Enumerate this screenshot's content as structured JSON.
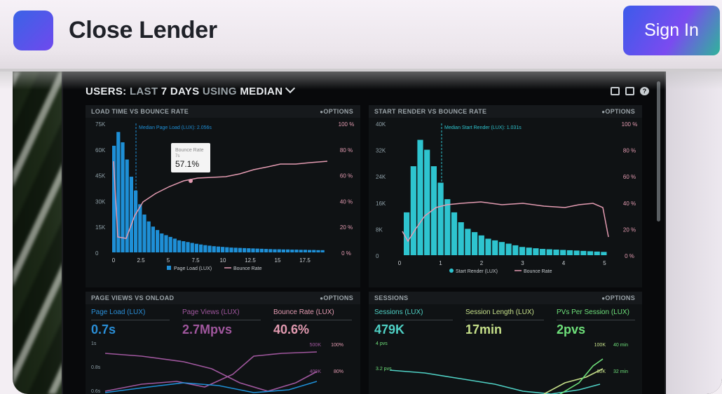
{
  "header": {
    "brand": "Close Lender",
    "sign_in_label": "Sign In",
    "logo_colors": [
      "#3a63e6",
      "#6f49ee"
    ]
  },
  "dashboard": {
    "title_users": "USERS:",
    "title_last": "LAST",
    "title_days": "7 DAYS",
    "title_using": "USING",
    "title_median": "MEDIAN",
    "icons": [
      "monitor-icon",
      "share-icon",
      "help-icon"
    ],
    "options_label": "OPTIONS",
    "panels": {
      "load": {
        "title": "LOAD TIME VS BOUNCE RATE",
        "median_label": "Median Page Load (LUX): 2.056s",
        "tooltip_label": "Bounce Rate",
        "tooltip_sub": "7s",
        "tooltip_value": "57.1%",
        "legend": [
          "Page Load (LUX)",
          "Bounce Rate"
        ]
      },
      "render": {
        "title": "START RENDER VS BOUNCE RATE",
        "median_label": "Median Start Render (LUX): 1.031s",
        "legend": [
          "Start Render (LUX)",
          "Bounce Rate"
        ]
      },
      "pageviews": {
        "title": "PAGE VIEWS VS ONLOAD",
        "metrics": [
          {
            "label": "Page Load (LUX)",
            "value": "0.7s",
            "color": "#2a8fd8"
          },
          {
            "label": "Page Views (LUX)",
            "value": "2.7Mpvs",
            "color": "#a0579e"
          },
          {
            "label": "Bounce Rate (LUX)",
            "value": "40.6%",
            "color": "#e39bb1"
          }
        ]
      },
      "sessions": {
        "title": "SESSIONS",
        "metrics": [
          {
            "label": "Sessions (LUX)",
            "value": "479K",
            "color": "#4fd1c5"
          },
          {
            "label": "Session Length (LUX)",
            "value": "17min",
            "color": "#c6e08a"
          },
          {
            "label": "PVs Per Session (LUX)",
            "value": "2pvs",
            "color": "#6ee07a"
          }
        ]
      }
    },
    "axes": {
      "load_y_left": [
        "75K",
        "60K",
        "45K",
        "30K",
        "15K",
        "0"
      ],
      "load_y_right": [
        "100 %",
        "80 %",
        "60 %",
        "40 %",
        "20 %",
        "0 %"
      ],
      "load_x": [
        "0",
        "2.5",
        "5",
        "7.5",
        "10",
        "12.5",
        "15",
        "17.5"
      ],
      "render_y_left": [
        "40K",
        "32K",
        "24K",
        "16K",
        "8K",
        "0"
      ],
      "render_y_right": [
        "100 %",
        "80 %",
        "60 %",
        "40 %",
        "20 %",
        "0 %"
      ],
      "render_x": [
        "0",
        "1",
        "2",
        "3",
        "4",
        "5"
      ],
      "pv_y_left": [
        "1s",
        "0.8s",
        "0.6s"
      ],
      "pv_y_right_a": [
        "500K",
        "400K"
      ],
      "pv_y_right_b": [
        "100%",
        "80%"
      ],
      "sess_y_left": [
        "4 pvs",
        "3.2 pvs"
      ],
      "sess_y_right_a": [
        "100K",
        "80K"
      ],
      "sess_y_right_b": [
        "40 min",
        "32 min"
      ]
    }
  }
}
